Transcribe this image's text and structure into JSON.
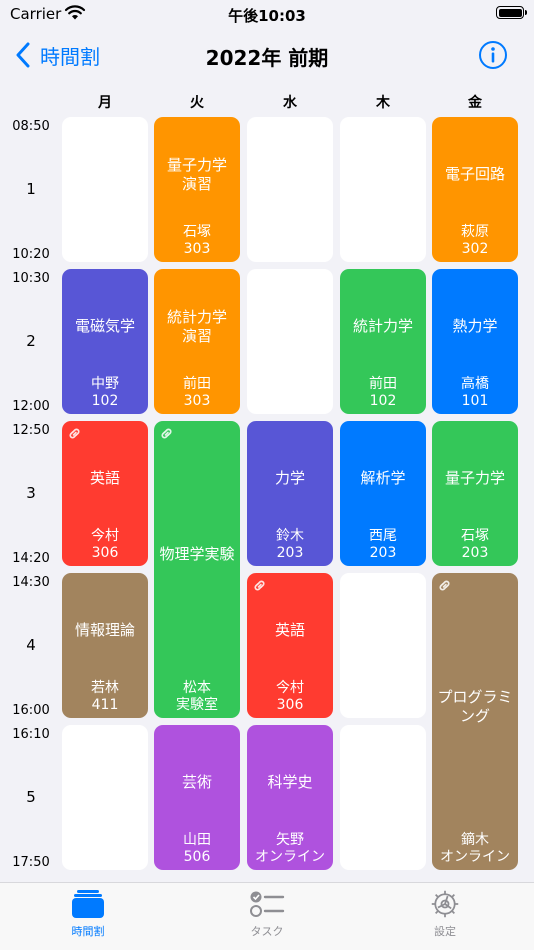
{
  "status_bar": {
    "carrier": "Carrier",
    "time": "午後10:03"
  },
  "nav": {
    "back_label": "時間割",
    "title": "2022年 前期"
  },
  "days": [
    "月",
    "火",
    "水",
    "木",
    "金"
  ],
  "periods": [
    {
      "number": "1",
      "start": "08:50",
      "end": "10:20"
    },
    {
      "number": "2",
      "start": "10:30",
      "end": "12:00"
    },
    {
      "number": "3",
      "start": "12:50",
      "end": "14:20"
    },
    {
      "number": "4",
      "start": "14:30",
      "end": "16:00"
    },
    {
      "number": "5",
      "start": "16:10",
      "end": "17:50"
    }
  ],
  "colors": {
    "orange": "#ff9500",
    "indigo": "#5856d6",
    "green": "#34c759",
    "blue": "#007aff",
    "red": "#ff3b30",
    "brown": "#a2845e",
    "purple": "#af52de",
    "empty": "#ffffff"
  },
  "classes": [
    {
      "day": 0,
      "period": 0,
      "span": 1,
      "empty": true
    },
    {
      "day": 1,
      "period": 0,
      "span": 1,
      "subject": "量子力学\n演習",
      "teacher": "石塚",
      "room": "303",
      "color": "#ff9500"
    },
    {
      "day": 2,
      "period": 0,
      "span": 1,
      "empty": true
    },
    {
      "day": 3,
      "period": 0,
      "span": 1,
      "empty": true
    },
    {
      "day": 4,
      "period": 0,
      "span": 1,
      "subject": "電子回路",
      "teacher": "萩原",
      "room": "302",
      "color": "#ff9500"
    },
    {
      "day": 0,
      "period": 1,
      "span": 1,
      "subject": "電磁気学",
      "teacher": "中野",
      "room": "102",
      "color": "#5856d6"
    },
    {
      "day": 1,
      "period": 1,
      "span": 1,
      "subject": "統計力学\n演習",
      "teacher": "前田",
      "room": "303",
      "color": "#ff9500"
    },
    {
      "day": 2,
      "period": 1,
      "span": 1,
      "empty": true
    },
    {
      "day": 3,
      "period": 1,
      "span": 1,
      "subject": "統計力学",
      "teacher": "前田",
      "room": "102",
      "color": "#34c759"
    },
    {
      "day": 4,
      "period": 1,
      "span": 1,
      "subject": "熱力学",
      "teacher": "高橋",
      "room": "101",
      "color": "#007aff"
    },
    {
      "day": 0,
      "period": 2,
      "span": 1,
      "subject": "英語",
      "teacher": "今村",
      "room": "306",
      "color": "#ff3b30",
      "linked": true
    },
    {
      "day": 1,
      "period": 2,
      "span": 2,
      "subject": "物理学実験",
      "teacher": "松本",
      "room": "実験室",
      "color": "#34c759",
      "linked": true
    },
    {
      "day": 2,
      "period": 2,
      "span": 1,
      "subject": "力学",
      "teacher": "鈴木",
      "room": "203",
      "color": "#5856d6"
    },
    {
      "day": 3,
      "period": 2,
      "span": 1,
      "subject": "解析学",
      "teacher": "西尾",
      "room": "203",
      "color": "#007aff"
    },
    {
      "day": 4,
      "period": 2,
      "span": 1,
      "subject": "量子力学",
      "teacher": "石塚",
      "room": "203",
      "color": "#34c759"
    },
    {
      "day": 0,
      "period": 3,
      "span": 1,
      "subject": "情報理論",
      "teacher": "若林",
      "room": "411",
      "color": "#a2845e"
    },
    {
      "day": 2,
      "period": 3,
      "span": 1,
      "subject": "英語",
      "teacher": "今村",
      "room": "306",
      "color": "#ff3b30",
      "linked": true
    },
    {
      "day": 3,
      "period": 3,
      "span": 1,
      "empty": true
    },
    {
      "day": 4,
      "period": 3,
      "span": 2,
      "subject": "プログラミ\nング",
      "teacher": "鏑木",
      "room": "オンライン",
      "color": "#a2845e",
      "linked": true
    },
    {
      "day": 0,
      "period": 4,
      "span": 1,
      "empty": true
    },
    {
      "day": 1,
      "period": 4,
      "span": 1,
      "subject": "芸術",
      "teacher": "山田",
      "room": "506",
      "color": "#af52de"
    },
    {
      "day": 2,
      "period": 4,
      "span": 1,
      "subject": "科学史",
      "teacher": "矢野",
      "room": "オンライン",
      "color": "#af52de"
    },
    {
      "day": 3,
      "period": 4,
      "span": 1,
      "empty": true
    }
  ],
  "tabs": [
    {
      "label": "時間割",
      "icon": "timetable-icon",
      "active": true
    },
    {
      "label": "タスク",
      "icon": "task-list-icon",
      "active": false
    },
    {
      "label": "設定",
      "icon": "gear-icon",
      "active": false
    }
  ]
}
